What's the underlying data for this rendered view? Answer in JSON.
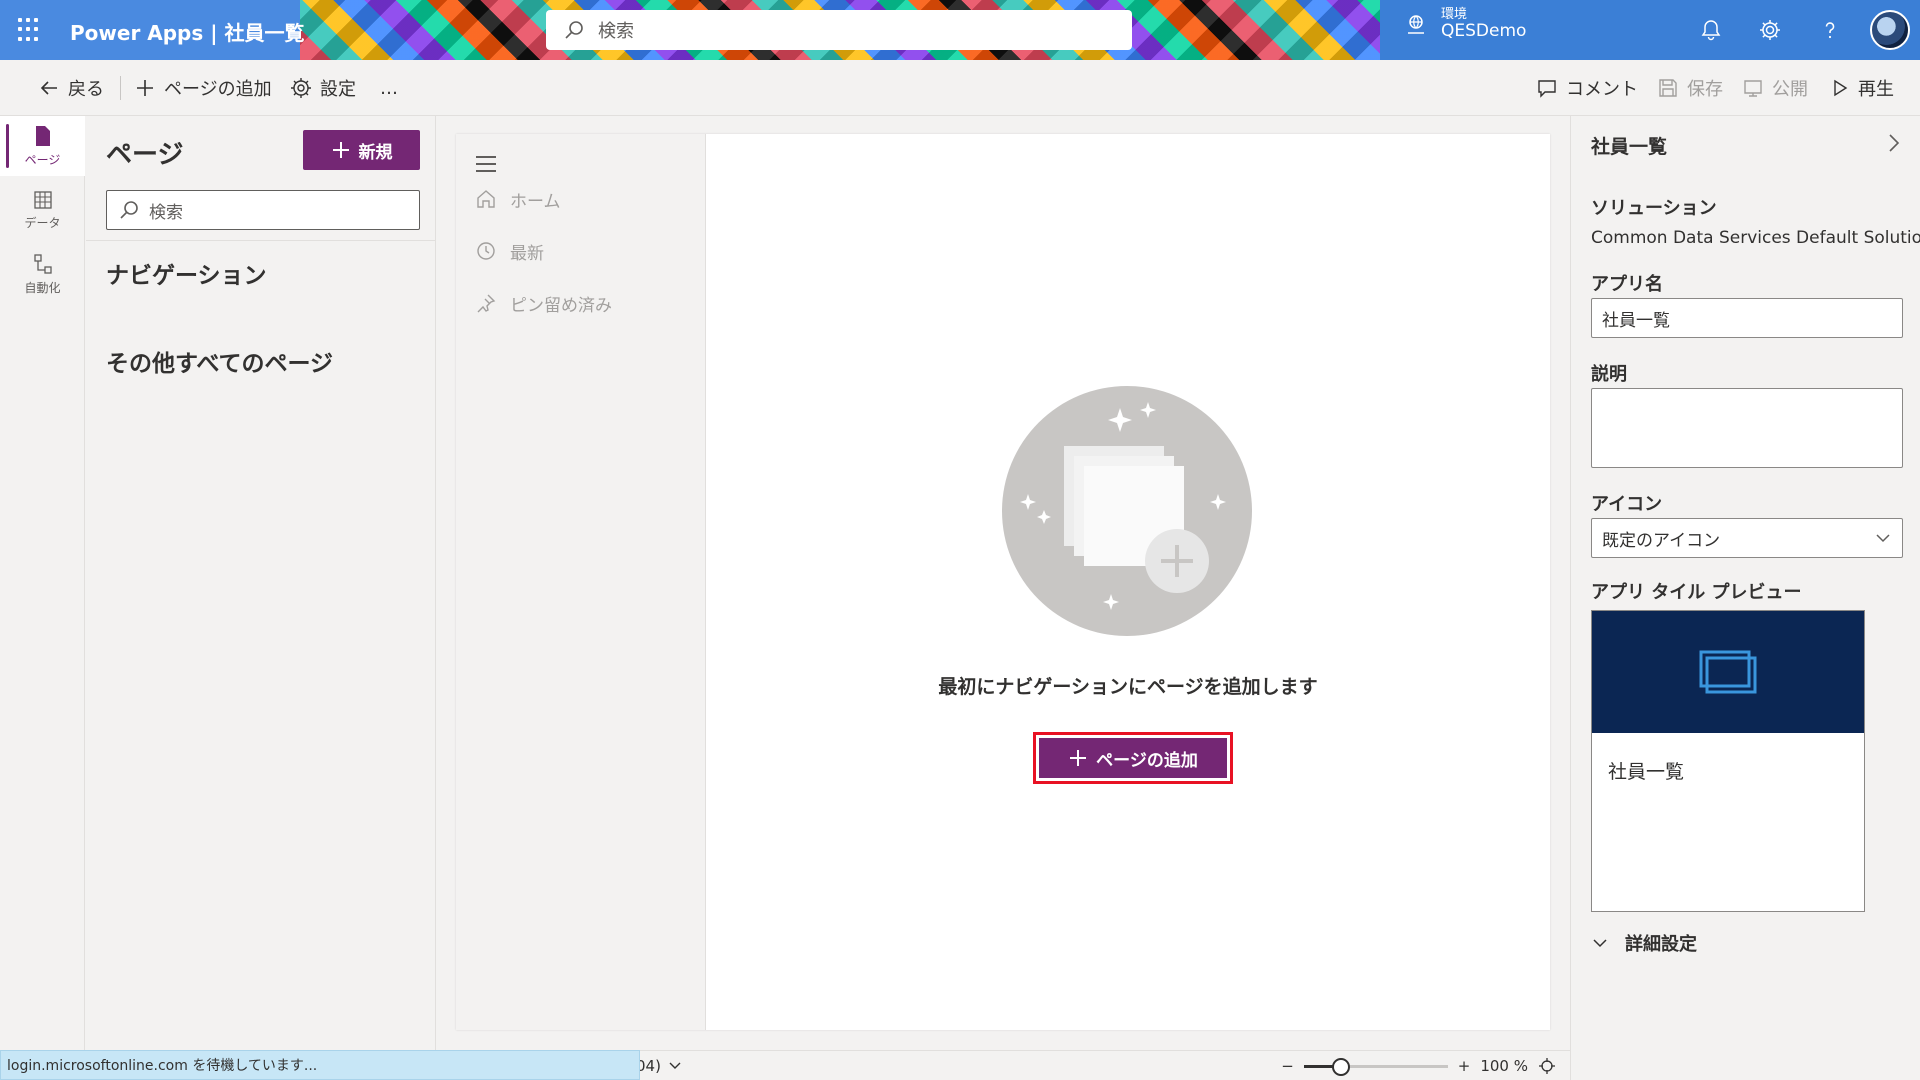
{
  "header": {
    "app_title": "Power Apps  |  社員一覧",
    "search_placeholder": "検索",
    "env_label": "環境",
    "env_name": "QESDemo"
  },
  "cmdbar": {
    "back": "戻る",
    "add_page": "ページの追加",
    "settings": "設定",
    "more": "…",
    "comment": "コメント",
    "save": "保存",
    "publish": "公開",
    "play": "再生"
  },
  "rail": {
    "pages": "ページ",
    "data": "データ",
    "automate": "自動化"
  },
  "pages_panel": {
    "title": "ページ",
    "new_label": "新規",
    "search_placeholder": "検索",
    "navigation_heading": "ナビゲーション",
    "other_heading": "その他すべてのページ"
  },
  "app_nav": {
    "items": [
      "ホーム",
      "最新",
      "ピン留め済み"
    ]
  },
  "empty_state": {
    "message": "最初にナビゲーションにページを追加します",
    "add_button": "ページの追加"
  },
  "props": {
    "title": "社員一覧",
    "solution_label": "ソリューション",
    "solution_value": "Common Data Services Default Solution",
    "app_name_label": "アプリ名",
    "app_name_value": "社員一覧",
    "description_label": "説明",
    "description_value": "",
    "icon_label": "アイコン",
    "icon_value": "既定のアイコン",
    "tile_preview_label": "アプリ タイル プレビュー",
    "tile_name": "社員一覧",
    "advanced_label": "詳細設定"
  },
  "bottom": {
    "version_fragment": "04)",
    "zoom_value": "100 %",
    "zoom_level": 100
  },
  "status": {
    "text": "login.microsoftonline.com を待機しています..."
  },
  "colors": {
    "accent": "#742774",
    "header": "#3b7fd6",
    "tile_bg": "#0b2653",
    "highlight": "#e81123"
  }
}
